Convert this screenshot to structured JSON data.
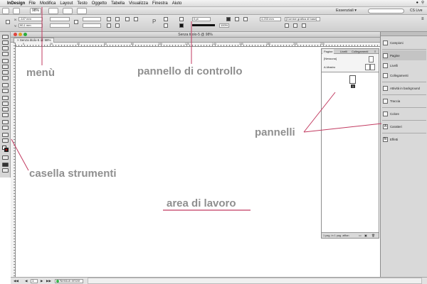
{
  "menubar": {
    "app": "InDesign",
    "items": [
      "File",
      "Modifica",
      "Layout",
      "Testo",
      "Oggetto",
      "Tabella",
      "Visualizza",
      "Finestra",
      "Aiuto"
    ]
  },
  "appbar": {
    "zoom": "98%",
    "workspace": "Essenziali ▾",
    "cs_live": "CS Live"
  },
  "control": {
    "x_value": "-147 mm",
    "y_value": "90,1 mm",
    "w_value": "",
    "h_value": "",
    "stroke_value": "0 pt",
    "width_value": "4,233 mm",
    "percent_value": "100%",
    "frame_label": "[Cornice grafica di base]"
  },
  "document": {
    "window_title": "Senza titolo-5 @ 98%",
    "tab_label": "Senza titolo-5 @ 98%",
    "ruler_ticks": [
      "0",
      "20",
      "40",
      "60",
      "80",
      "100",
      "120",
      "140",
      "160",
      "180",
      "200",
      "220"
    ]
  },
  "statusbar": {
    "page": "1",
    "errors": "Nessun errore"
  },
  "pages_panel": {
    "tabs": [
      "Pagine",
      "Livelli",
      "Collegamenti"
    ],
    "master_none": "[Nessuna]",
    "master_a": "A-Mastro",
    "page_number": "1",
    "footer": "1 pag. in 1 pag. affian"
  },
  "dock": {
    "items": [
      {
        "label": "Campioni",
        "icon": "swatches-icon"
      },
      {
        "label": "Pagine",
        "icon": "pages-icon"
      },
      {
        "label": "Livelli",
        "icon": "layers-icon"
      },
      {
        "label": "Collegamenti",
        "icon": "links-icon"
      },
      {
        "label": "Attività in background",
        "icon": "background-tasks-icon"
      },
      {
        "label": "Traccia",
        "icon": "stroke-icon"
      },
      {
        "label": "Colore",
        "icon": "color-icon"
      },
      {
        "label": "Caratteri",
        "icon": "character-icon"
      },
      {
        "label": "Effetti",
        "icon": "effects-icon"
      }
    ]
  },
  "annotations": {
    "menu": "menù",
    "control_panel": "pannello di controllo",
    "panels": "pannelli",
    "toolbox": "casella strumenti",
    "work_area": "area di lavoro"
  },
  "colors": {
    "annotation_text": "#8f8f8f",
    "annotation_line": "#c23a60"
  }
}
